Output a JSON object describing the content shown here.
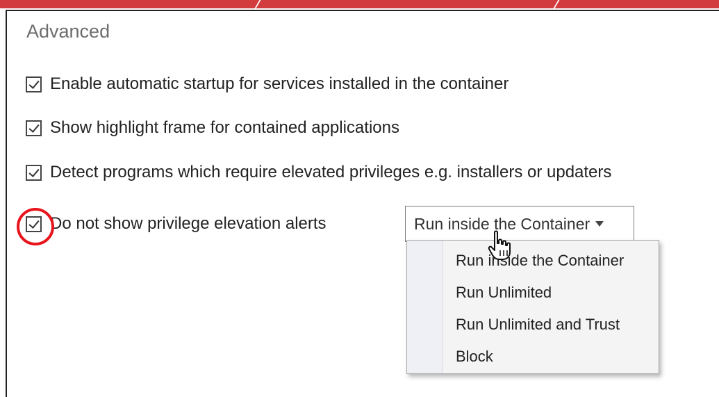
{
  "section": {
    "title": "Advanced"
  },
  "options": [
    {
      "label": "Enable automatic startup for services installed in the container",
      "checked": true
    },
    {
      "label": "Show highlight frame for contained applications",
      "checked": true
    },
    {
      "label": "Detect programs which require elevated privileges e.g. installers or updaters",
      "checked": true
    },
    {
      "label": "Do not show privilege elevation alerts",
      "checked": true
    }
  ],
  "elevation_select": {
    "value": "Run inside the Container",
    "options": [
      "Run inside the Container",
      "Run Unlimited",
      "Run Unlimited and Trust",
      "Block"
    ],
    "expanded": true
  },
  "colors": {
    "header": "#d23c3f",
    "highlight": "#e8141c",
    "dropdown_bg": "#f4f4f4"
  },
  "icons": {
    "caret": "chevron-down-icon",
    "cursor": "hand-pointer-icon"
  }
}
